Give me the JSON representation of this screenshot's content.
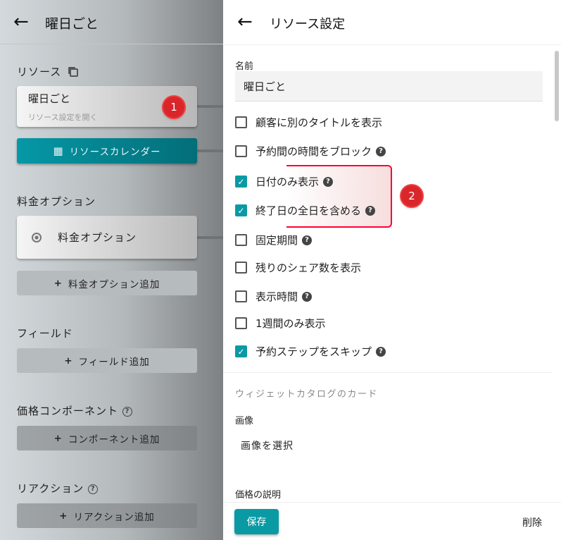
{
  "left": {
    "title": "曜日ごと",
    "resource_label": "リソース",
    "resource_card": {
      "title": "曜日ごと",
      "subtitle": "リソース設定を開く"
    },
    "badge1": "1",
    "calendar_button": "リソースカレンダー",
    "price_options_label": "料金オプション",
    "price_option_card": "料金オプション",
    "add_price_option": "料金オプション追加",
    "fields_label": "フィールド",
    "add_field": "フィールド追加",
    "price_components_label": "価格コンポーネント",
    "add_component": "コンポーネント追加",
    "reactions_label": "リアクション",
    "add_reaction": "リアクション追加"
  },
  "right": {
    "title": "リソース設定",
    "name_label": "名前",
    "name_value": "曜日ごと",
    "options": [
      {
        "label": "顧客に別のタイトルを表示",
        "checked": false,
        "help": false
      },
      {
        "label": "予約間の時間をブロック",
        "checked": false,
        "help": true
      },
      {
        "label": "日付のみ表示",
        "checked": true,
        "help": true
      },
      {
        "label": "終了日の全日を含める",
        "checked": true,
        "help": true
      },
      {
        "label": "固定期間",
        "checked": false,
        "help": true
      },
      {
        "label": "残りのシェア数を表示",
        "checked": false,
        "help": false
      },
      {
        "label": "表示時間",
        "checked": false,
        "help": true
      },
      {
        "label": "1週間のみ表示",
        "checked": false,
        "help": false
      },
      {
        "label": "予約ステップをスキップ",
        "checked": true,
        "help": true
      }
    ],
    "badge2": "2",
    "widget_section": "ウィジェットカタログのカード",
    "image_label": "画像",
    "select_image": "画像を選択",
    "price_desc_label": "価格の説明",
    "save": "保存",
    "delete": "削除"
  },
  "colors": {
    "accent": "#0a9aa4",
    "badge": "#d9262b"
  }
}
